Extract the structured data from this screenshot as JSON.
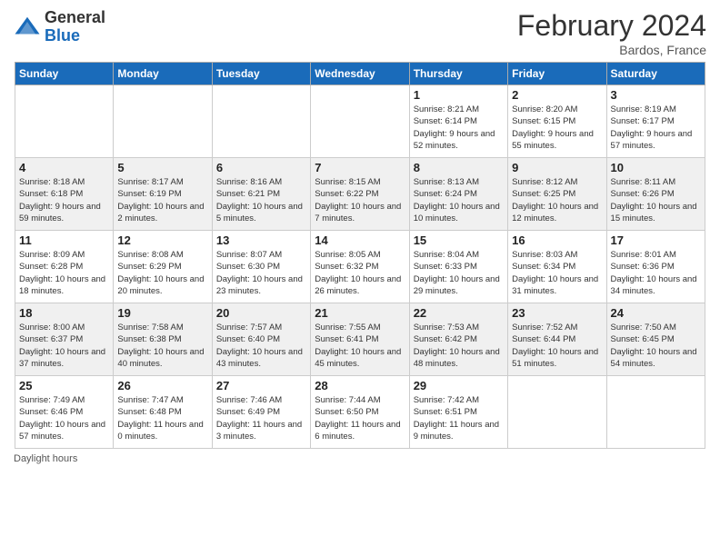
{
  "header": {
    "logo": {
      "general": "General",
      "blue": "Blue"
    },
    "title": "February 2024",
    "location": "Bardos, France"
  },
  "days_of_week": [
    "Sunday",
    "Monday",
    "Tuesday",
    "Wednesday",
    "Thursday",
    "Friday",
    "Saturday"
  ],
  "weeks": [
    [
      {
        "day": "",
        "sunrise": "",
        "sunset": "",
        "daylight": ""
      },
      {
        "day": "",
        "sunrise": "",
        "sunset": "",
        "daylight": ""
      },
      {
        "day": "",
        "sunrise": "",
        "sunset": "",
        "daylight": ""
      },
      {
        "day": "",
        "sunrise": "",
        "sunset": "",
        "daylight": ""
      },
      {
        "day": "1",
        "sunrise": "Sunrise: 8:21 AM",
        "sunset": "Sunset: 6:14 PM",
        "daylight": "Daylight: 9 hours and 52 minutes."
      },
      {
        "day": "2",
        "sunrise": "Sunrise: 8:20 AM",
        "sunset": "Sunset: 6:15 PM",
        "daylight": "Daylight: 9 hours and 55 minutes."
      },
      {
        "day": "3",
        "sunrise": "Sunrise: 8:19 AM",
        "sunset": "Sunset: 6:17 PM",
        "daylight": "Daylight: 9 hours and 57 minutes."
      }
    ],
    [
      {
        "day": "4",
        "sunrise": "Sunrise: 8:18 AM",
        "sunset": "Sunset: 6:18 PM",
        "daylight": "Daylight: 9 hours and 59 minutes."
      },
      {
        "day": "5",
        "sunrise": "Sunrise: 8:17 AM",
        "sunset": "Sunset: 6:19 PM",
        "daylight": "Daylight: 10 hours and 2 minutes."
      },
      {
        "day": "6",
        "sunrise": "Sunrise: 8:16 AM",
        "sunset": "Sunset: 6:21 PM",
        "daylight": "Daylight: 10 hours and 5 minutes."
      },
      {
        "day": "7",
        "sunrise": "Sunrise: 8:15 AM",
        "sunset": "Sunset: 6:22 PM",
        "daylight": "Daylight: 10 hours and 7 minutes."
      },
      {
        "day": "8",
        "sunrise": "Sunrise: 8:13 AM",
        "sunset": "Sunset: 6:24 PM",
        "daylight": "Daylight: 10 hours and 10 minutes."
      },
      {
        "day": "9",
        "sunrise": "Sunrise: 8:12 AM",
        "sunset": "Sunset: 6:25 PM",
        "daylight": "Daylight: 10 hours and 12 minutes."
      },
      {
        "day": "10",
        "sunrise": "Sunrise: 8:11 AM",
        "sunset": "Sunset: 6:26 PM",
        "daylight": "Daylight: 10 hours and 15 minutes."
      }
    ],
    [
      {
        "day": "11",
        "sunrise": "Sunrise: 8:09 AM",
        "sunset": "Sunset: 6:28 PM",
        "daylight": "Daylight: 10 hours and 18 minutes."
      },
      {
        "day": "12",
        "sunrise": "Sunrise: 8:08 AM",
        "sunset": "Sunset: 6:29 PM",
        "daylight": "Daylight: 10 hours and 20 minutes."
      },
      {
        "day": "13",
        "sunrise": "Sunrise: 8:07 AM",
        "sunset": "Sunset: 6:30 PM",
        "daylight": "Daylight: 10 hours and 23 minutes."
      },
      {
        "day": "14",
        "sunrise": "Sunrise: 8:05 AM",
        "sunset": "Sunset: 6:32 PM",
        "daylight": "Daylight: 10 hours and 26 minutes."
      },
      {
        "day": "15",
        "sunrise": "Sunrise: 8:04 AM",
        "sunset": "Sunset: 6:33 PM",
        "daylight": "Daylight: 10 hours and 29 minutes."
      },
      {
        "day": "16",
        "sunrise": "Sunrise: 8:03 AM",
        "sunset": "Sunset: 6:34 PM",
        "daylight": "Daylight: 10 hours and 31 minutes."
      },
      {
        "day": "17",
        "sunrise": "Sunrise: 8:01 AM",
        "sunset": "Sunset: 6:36 PM",
        "daylight": "Daylight: 10 hours and 34 minutes."
      }
    ],
    [
      {
        "day": "18",
        "sunrise": "Sunrise: 8:00 AM",
        "sunset": "Sunset: 6:37 PM",
        "daylight": "Daylight: 10 hours and 37 minutes."
      },
      {
        "day": "19",
        "sunrise": "Sunrise: 7:58 AM",
        "sunset": "Sunset: 6:38 PM",
        "daylight": "Daylight: 10 hours and 40 minutes."
      },
      {
        "day": "20",
        "sunrise": "Sunrise: 7:57 AM",
        "sunset": "Sunset: 6:40 PM",
        "daylight": "Daylight: 10 hours and 43 minutes."
      },
      {
        "day": "21",
        "sunrise": "Sunrise: 7:55 AM",
        "sunset": "Sunset: 6:41 PM",
        "daylight": "Daylight: 10 hours and 45 minutes."
      },
      {
        "day": "22",
        "sunrise": "Sunrise: 7:53 AM",
        "sunset": "Sunset: 6:42 PM",
        "daylight": "Daylight: 10 hours and 48 minutes."
      },
      {
        "day": "23",
        "sunrise": "Sunrise: 7:52 AM",
        "sunset": "Sunset: 6:44 PM",
        "daylight": "Daylight: 10 hours and 51 minutes."
      },
      {
        "day": "24",
        "sunrise": "Sunrise: 7:50 AM",
        "sunset": "Sunset: 6:45 PM",
        "daylight": "Daylight: 10 hours and 54 minutes."
      }
    ],
    [
      {
        "day": "25",
        "sunrise": "Sunrise: 7:49 AM",
        "sunset": "Sunset: 6:46 PM",
        "daylight": "Daylight: 10 hours and 57 minutes."
      },
      {
        "day": "26",
        "sunrise": "Sunrise: 7:47 AM",
        "sunset": "Sunset: 6:48 PM",
        "daylight": "Daylight: 11 hours and 0 minutes."
      },
      {
        "day": "27",
        "sunrise": "Sunrise: 7:46 AM",
        "sunset": "Sunset: 6:49 PM",
        "daylight": "Daylight: 11 hours and 3 minutes."
      },
      {
        "day": "28",
        "sunrise": "Sunrise: 7:44 AM",
        "sunset": "Sunset: 6:50 PM",
        "daylight": "Daylight: 11 hours and 6 minutes."
      },
      {
        "day": "29",
        "sunrise": "Sunrise: 7:42 AM",
        "sunset": "Sunset: 6:51 PM",
        "daylight": "Daylight: 11 hours and 9 minutes."
      },
      {
        "day": "",
        "sunrise": "",
        "sunset": "",
        "daylight": ""
      },
      {
        "day": "",
        "sunrise": "",
        "sunset": "",
        "daylight": ""
      }
    ]
  ],
  "footer": {
    "daylight_label": "Daylight hours"
  }
}
